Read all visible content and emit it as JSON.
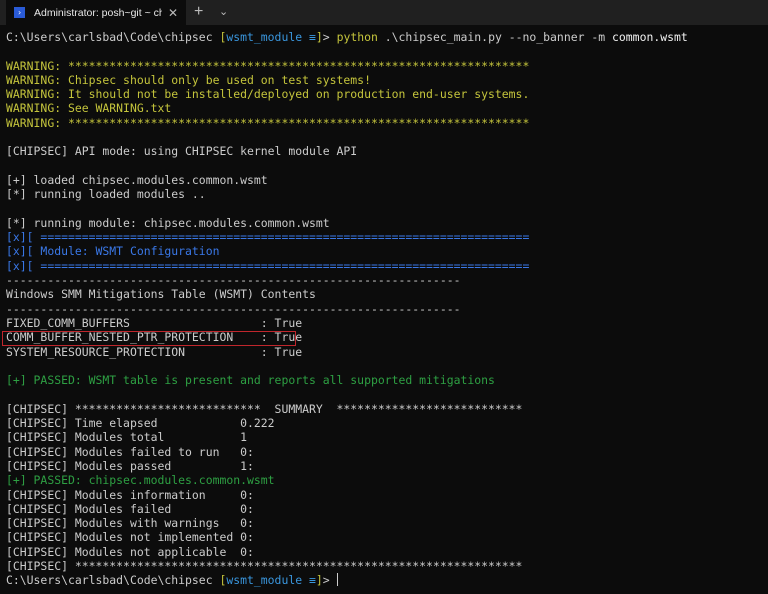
{
  "colors": {
    "default": "#cccccc",
    "yellow": "#c5c53c",
    "blue": "#3a78e8",
    "green": "#2ea043",
    "cyan": "#3a96dd",
    "white": "#f2f2f2",
    "highlight": "#c0262c"
  },
  "tab": {
    "title": "Administrator: posh~git ~ chipsec",
    "icon": "powershell-icon",
    "close": "✕",
    "new": "+",
    "dropdown": "⌄"
  },
  "lines": [
    [
      {
        "t": "C:\\Users\\carlsbad\\Code\\chipsec ",
        "c": "default"
      },
      {
        "t": "[",
        "c": "yellow"
      },
      {
        "t": "wsmt_module ≡",
        "c": "cyan"
      },
      {
        "t": "]",
        "c": "yellow"
      },
      {
        "t": "> ",
        "c": "default"
      },
      {
        "t": "python",
        "c": "yellow"
      },
      {
        "t": " .\\chipsec_main.py ",
        "c": "default"
      },
      {
        "t": "--no_banner -m",
        "c": "default"
      },
      {
        "t": " common.wsmt",
        "c": "white"
      }
    ],
    [],
    [
      {
        "t": "WARNING: *******************************************************************",
        "c": "yellow"
      }
    ],
    [
      {
        "t": "WARNING: Chipsec should only be used on test systems!",
        "c": "yellow"
      }
    ],
    [
      {
        "t": "WARNING: It should not be installed/deployed on production end-user systems.",
        "c": "yellow"
      }
    ],
    [
      {
        "t": "WARNING: See WARNING.txt",
        "c": "yellow"
      }
    ],
    [
      {
        "t": "WARNING: *******************************************************************",
        "c": "yellow"
      }
    ],
    [],
    [
      {
        "t": "[CHIPSEC] API mode: using CHIPSEC kernel module API",
        "c": "default"
      }
    ],
    [],
    [
      {
        "t": "[+] loaded chipsec.modules.common.wsmt",
        "c": "default"
      }
    ],
    [
      {
        "t": "[*] running loaded modules ..",
        "c": "default"
      }
    ],
    [],
    [
      {
        "t": "[*] running module: chipsec.modules.common.wsmt",
        "c": "default"
      }
    ],
    [
      {
        "t": "[x][ =======================================================================",
        "c": "blue"
      }
    ],
    [
      {
        "t": "[x][ Module: WSMT Configuration",
        "c": "blue"
      }
    ],
    [
      {
        "t": "[x][ =======================================================================",
        "c": "blue"
      }
    ],
    [
      {
        "t": "------------------------------------------------------------------",
        "c": "default"
      }
    ],
    [
      {
        "t": "Windows SMM Mitigations Table (WSMT) Contents",
        "c": "default"
      }
    ],
    [
      {
        "t": "------------------------------------------------------------------",
        "c": "default"
      }
    ],
    [
      {
        "t": "FIXED_COMM_BUFFERS                   : True",
        "c": "default"
      }
    ],
    [
      {
        "t": "COMM_BUFFER_NESTED_PTR_PROTECTION    : True",
        "c": "default"
      }
    ],
    [
      {
        "t": "SYSTEM_RESOURCE_PROTECTION           : True",
        "c": "default"
      }
    ],
    [],
    [
      {
        "t": "[+] PASSED: WSMT table is present and reports all supported mitigations",
        "c": "green"
      }
    ],
    [],
    [
      {
        "t": "[CHIPSEC] ***************************  SUMMARY  ***************************",
        "c": "default"
      }
    ],
    [
      {
        "t": "[CHIPSEC] Time elapsed            0.222",
        "c": "default"
      }
    ],
    [
      {
        "t": "[CHIPSEC] Modules total           1",
        "c": "default"
      }
    ],
    [
      {
        "t": "[CHIPSEC] Modules failed to run   0:",
        "c": "default"
      }
    ],
    [
      {
        "t": "[CHIPSEC] Modules passed          1:",
        "c": "default"
      }
    ],
    [
      {
        "t": "[+] PASSED: chipsec.modules.common.wsmt",
        "c": "green"
      }
    ],
    [
      {
        "t": "[CHIPSEC] Modules information     0:",
        "c": "default"
      }
    ],
    [
      {
        "t": "[CHIPSEC] Modules failed          0:",
        "c": "default"
      }
    ],
    [
      {
        "t": "[CHIPSEC] Modules with warnings   0:",
        "c": "default"
      }
    ],
    [
      {
        "t": "[CHIPSEC] Modules not implemented 0:",
        "c": "default"
      }
    ],
    [
      {
        "t": "[CHIPSEC] Modules not applicable  0:",
        "c": "default"
      }
    ],
    [
      {
        "t": "[CHIPSEC] *****************************************************************",
        "c": "default"
      }
    ],
    [
      {
        "t": "C:\\Users\\carlsbad\\Code\\chipsec ",
        "c": "default"
      },
      {
        "t": "[",
        "c": "yellow"
      },
      {
        "t": "wsmt_module ≡",
        "c": "cyan"
      },
      {
        "t": "]",
        "c": "yellow"
      },
      {
        "t": "> ",
        "c": "default"
      }
    ]
  ]
}
